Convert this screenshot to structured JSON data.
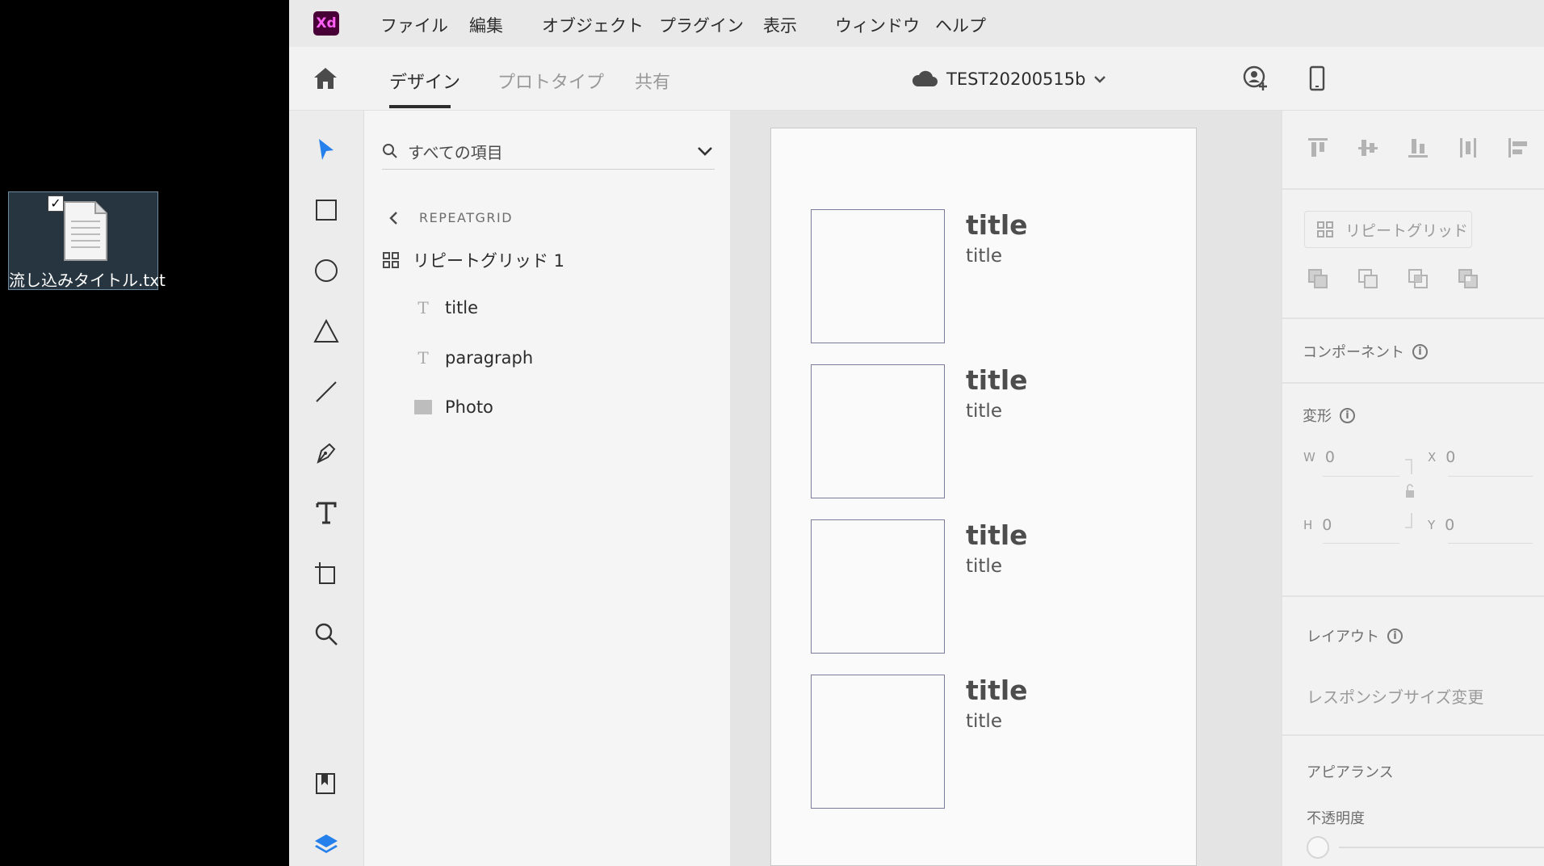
{
  "desktop": {
    "file_name": "流し込みタイトル.txt",
    "file_checked": "✓"
  },
  "menubar": {
    "logo": "Xd",
    "items": [
      "ファイル",
      "編集",
      "オブジェクト",
      "プラグイン",
      "表示",
      "ウィンドウ",
      "ヘルプ"
    ]
  },
  "tabbar": {
    "tabs": [
      "デザイン",
      "プロトタイプ",
      "共有"
    ],
    "active_tab": "デザイン",
    "document_title": "TEST20200515b"
  },
  "layers": {
    "search_placeholder": "すべての項目",
    "breadcrumb": "REPEATGRID",
    "group_name": "リピートグリッド 1",
    "children": [
      {
        "type": "text",
        "name": "title"
      },
      {
        "type": "text",
        "name": "paragraph"
      },
      {
        "type": "shape",
        "name": "Photo"
      }
    ]
  },
  "artboard": {
    "cards": [
      {
        "title": "title",
        "paragraph": "title"
      },
      {
        "title": "title",
        "paragraph": "title"
      },
      {
        "title": "title",
        "paragraph": "title"
      },
      {
        "title": "title",
        "paragraph": "title"
      }
    ]
  },
  "props": {
    "repeat_grid_button": "リピートグリッド",
    "component_label": "コンポーネント",
    "transform_label": "変形",
    "w_label": "W",
    "w_value": "0",
    "h_label": "H",
    "h_value": "0",
    "x_label": "X",
    "x_value": "0",
    "y_label": "Y",
    "y_value": "0",
    "layout_label": "レイアウト",
    "responsive_resize": "レスポンシブサイズ変更",
    "appearance_label": "アピアランス",
    "opacity_label": "不透明度"
  },
  "colors": {
    "accent": "#2680eb",
    "xd_logo_bg": "#470137",
    "xd_logo_fg": "#ff61f6"
  }
}
